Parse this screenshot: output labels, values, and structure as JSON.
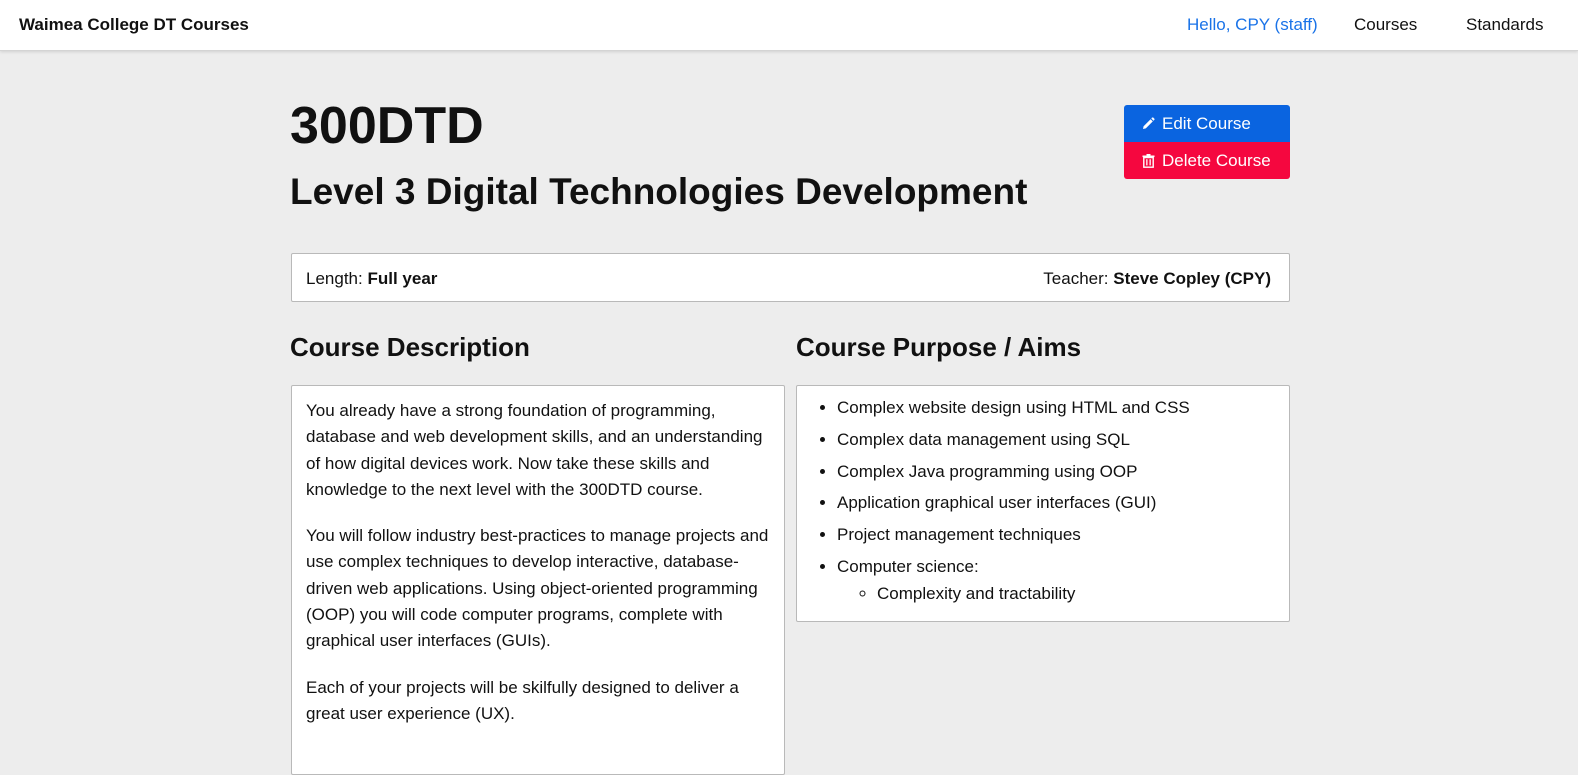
{
  "navbar": {
    "brand": "Waimea College DT Courses",
    "user_greeting": "Hello, CPY (staff)",
    "courses_link": "Courses",
    "standards_link": "Standards"
  },
  "course": {
    "code": "300DTD",
    "name": "Level 3 Digital Technologies Development"
  },
  "actions": {
    "edit_label": "Edit Course",
    "delete_label": "Delete Course",
    "edit_icon": "pencil-icon",
    "delete_icon": "trash-icon"
  },
  "info": {
    "length_label": "Length:",
    "length_value": "Full year",
    "teacher_label": "Teacher:",
    "teacher_value": "Steve Copley (CPY)"
  },
  "description": {
    "heading": "Course Description",
    "paragraphs": [
      "You already have a strong foundation of programming, database and web development skills, and an understanding of how digital devices work. Now take these skills and knowledge to the next level with the 300DTD course.",
      "You will follow industry best-practices to manage projects and use complex techniques to develop interactive, database-driven web applications. Using object-oriented programming (OOP) you will code computer programs, complete with graphical user interfaces (GUIs).",
      "Each of your projects will be skilfully designed to deliver a great user experience (UX)."
    ]
  },
  "aims": {
    "heading": "Course Purpose / Aims",
    "items": [
      "Complex website design using HTML and CSS",
      "Complex data management using SQL",
      "Complex Java programming using OOP",
      "Application graphical user interfaces (GUI)",
      "Project management techniques",
      "Computer science:"
    ],
    "sub_items": [
      "Complexity and tractability"
    ]
  },
  "colors": {
    "edit_button": "#0a64e0",
    "delete_button": "#f5073f",
    "link": "#1a73e8",
    "page_background": "#ededed"
  }
}
